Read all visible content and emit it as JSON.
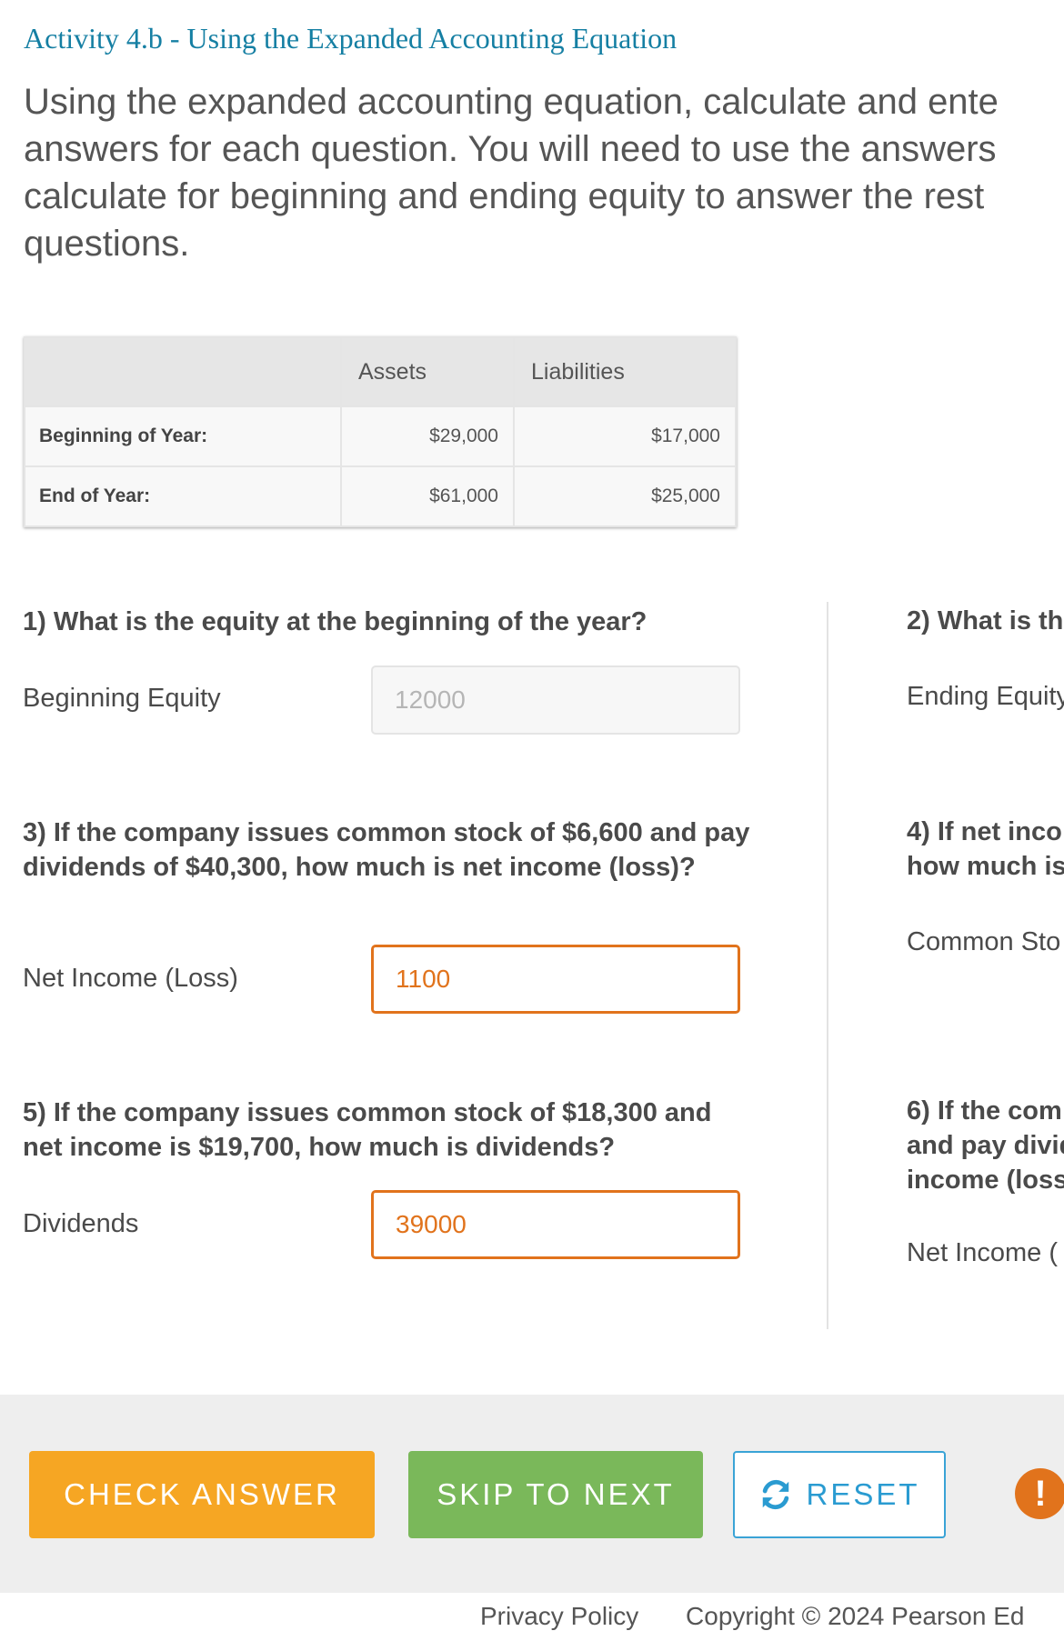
{
  "activity": {
    "title": "Activity 4.b - Using the Expanded Accounting Equation",
    "instructions": "Using the expanded accounting equation, calculate and ente answers for each question. You will need to use the answers calculate for beginning and ending equity to answer the rest questions."
  },
  "table": {
    "headers": [
      "",
      "Assets",
      "Liabilities"
    ],
    "rows": [
      {
        "label": "Beginning of Year:",
        "assets": "$29,000",
        "liabilities": "$17,000"
      },
      {
        "label": "End of Year:",
        "assets": "$61,000",
        "liabilities": "$25,000"
      }
    ]
  },
  "questions": {
    "q1": {
      "text": "1) What is the equity at the beginning of the year?",
      "field_label": "Beginning Equity",
      "value": "12000"
    },
    "q2": {
      "text": "2) What is th",
      "field_label": "Ending Equity"
    },
    "q3": {
      "text": "3) If the company issues common stock of $6,600 and pay dividends of $40,300, how much is net income (loss)?",
      "field_label": "Net Income (Loss)",
      "value": "1100"
    },
    "q4": {
      "line1": "4) If net inco",
      "line2": "how much is",
      "field_label": "Common Sto"
    },
    "q5": {
      "text": "5) If the company issues common stock of $18,300 and net income is $19,700, how much is dividends?",
      "field_label": "Dividends",
      "value": "39000"
    },
    "q6": {
      "line1": "6) If the com",
      "line2": "and pay divid",
      "line3": "income (loss",
      "field_label": "Net Income ("
    }
  },
  "buttons": {
    "check": "CHECK ANSWER",
    "skip": "SKIP TO NEXT",
    "reset": "RESET",
    "alert": "!"
  },
  "icons": {
    "reset": "refresh-icon",
    "alert": "exclamation-icon"
  },
  "colors": {
    "title": "#157fa3",
    "check": "#f6a623",
    "skip": "#7ab85a",
    "reset": "#2a9bd1",
    "active_input": "#e1731c"
  },
  "footer": {
    "privacy": "Privacy Policy",
    "copyright": "Copyright © 2024 Pearson Ed"
  }
}
